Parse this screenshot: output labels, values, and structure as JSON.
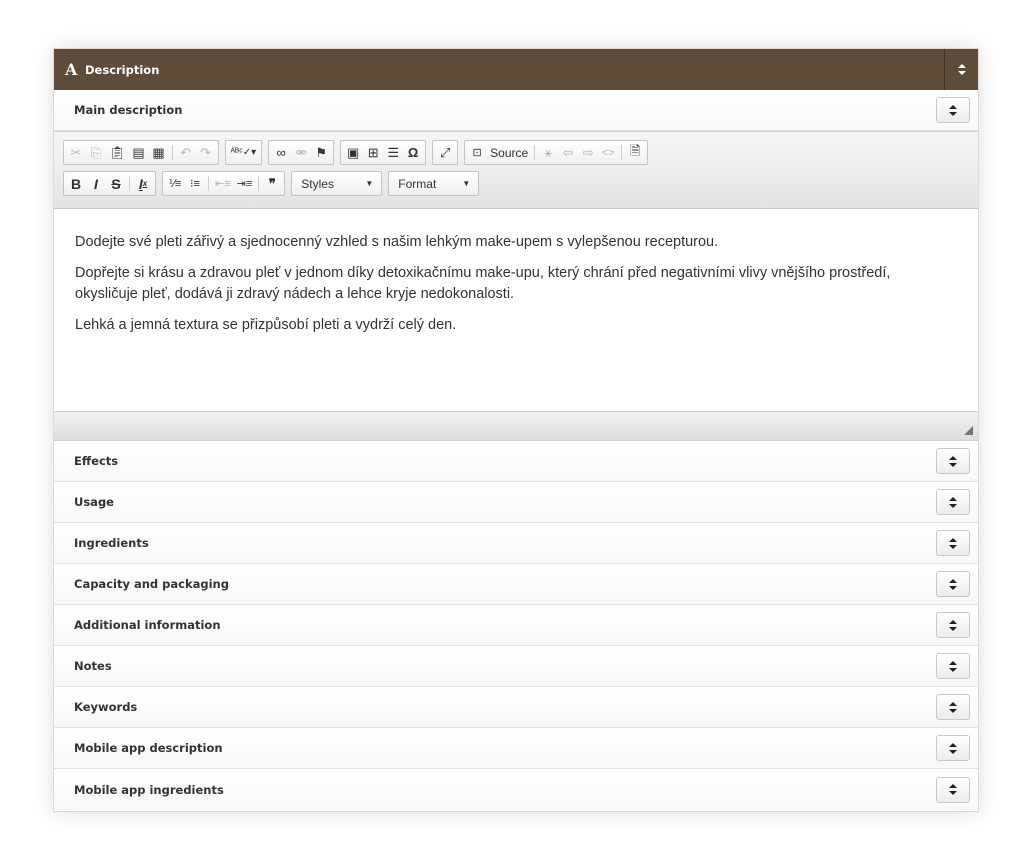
{
  "header": {
    "icon": "font-icon",
    "icon_glyph": "A",
    "title": "Description",
    "sort_glyph": "⬍"
  },
  "main_section": {
    "label": "Main description"
  },
  "toolbar": {
    "source_label": "Source",
    "styles_label": "Styles",
    "format_label": "Format",
    "bold": "B",
    "italic": "I",
    "strike": "S",
    "blockquote": "❞"
  },
  "content": {
    "paragraphs": [
      "Dodejte své pleti zářivý a sjednocenný vzhled s našim lehkým make-upem s vylepšenou recepturou.",
      "Dopřejte si krásu a zdravou pleť v jednom díky detoxikačnímu make-upu, který chrání před negativními vlivy vnějšího prostředí, okysličuje pleť, dodává ji zdravý nádech a lehce kryje nedokonalosti.",
      "Lehká a jemná textura se přizpůsobí pleti a vydrží celý den."
    ]
  },
  "sections": [
    {
      "label": "Effects"
    },
    {
      "label": "Usage"
    },
    {
      "label": "Ingredients"
    },
    {
      "label": "Capacity and packaging"
    },
    {
      "label": "Additional information"
    },
    {
      "label": "Notes"
    },
    {
      "label": "Keywords"
    },
    {
      "label": "Mobile app description"
    },
    {
      "label": "Mobile app ingredients"
    }
  ],
  "colors": {
    "header_bg": "#5e4b38",
    "header_text": "#ffffff"
  }
}
